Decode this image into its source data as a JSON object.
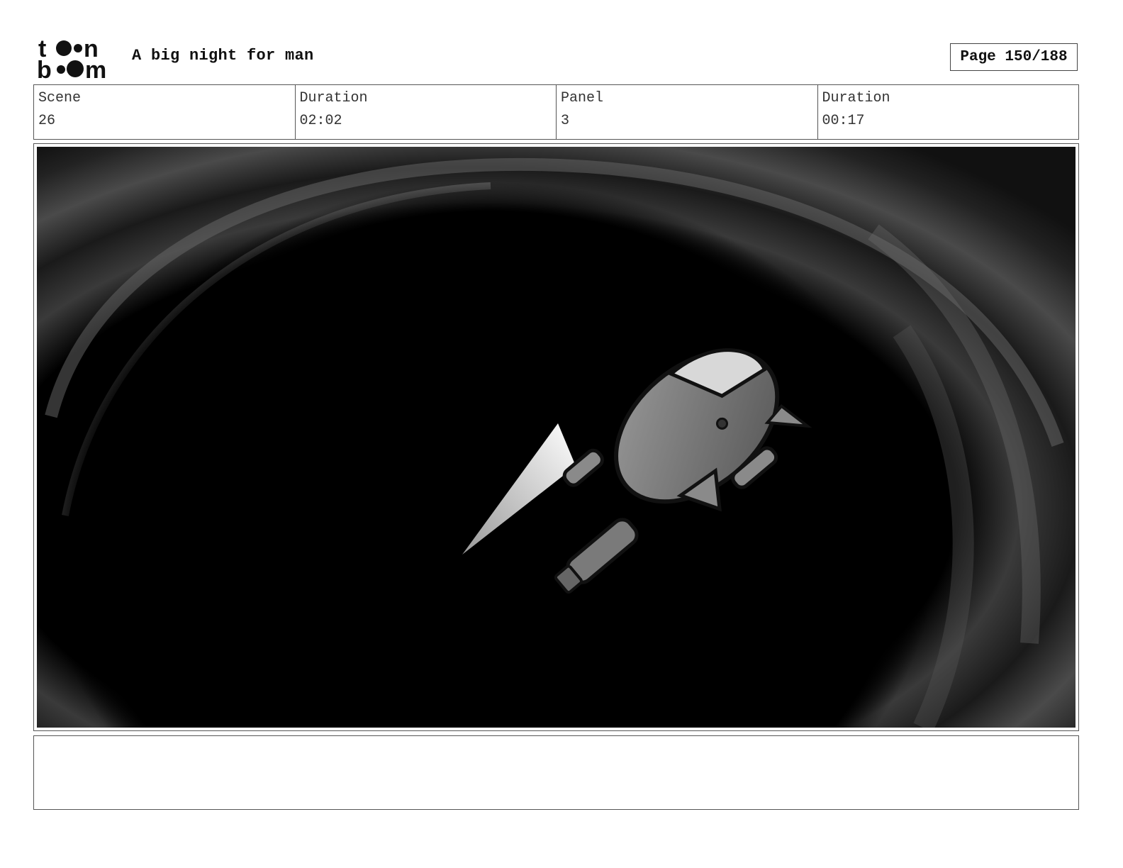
{
  "header": {
    "logo_top": "t●●n",
    "logo_bottom": "b●●m",
    "title": "A big night for man",
    "page_label": "Page 150/188"
  },
  "info": {
    "scene_label": "Scene",
    "scene_value": "26",
    "scene_duration_label": "Duration",
    "scene_duration_value": "02:02",
    "panel_label": "Panel",
    "panel_value": "3",
    "panel_duration_label": "Duration",
    "panel_duration_value": "00:17"
  },
  "panel": {
    "icon": "storyboard-drawing-rocket-in-space"
  },
  "notes": {
    "text": ""
  }
}
